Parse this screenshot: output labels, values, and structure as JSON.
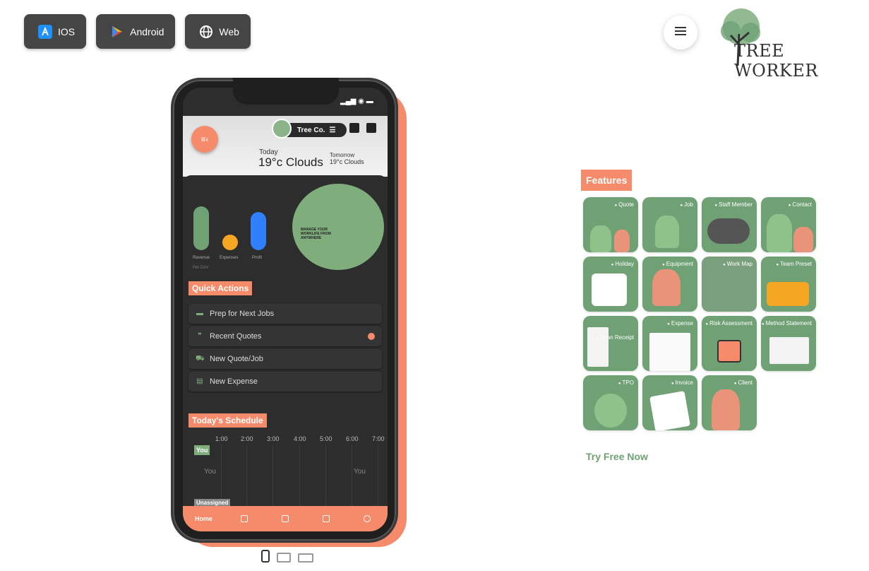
{
  "platforms": [
    {
      "label": "IOS",
      "icon": "app-store-icon"
    },
    {
      "label": "Android",
      "icon": "play-store-icon"
    },
    {
      "label": "Web",
      "icon": "globe-icon"
    }
  ],
  "brand": {
    "logo_text": "TREE WORKER"
  },
  "app": {
    "company": "Tree Co.",
    "weather": {
      "today_label": "Today",
      "today_value": "19°c Clouds",
      "tomorrow_label": "Tomorrow",
      "tomorrow_value": "19°c Clouds"
    },
    "stats": {
      "labels": [
        "Revenue",
        "Expenses",
        "Profit"
      ],
      "period": "Per DAY"
    },
    "hero_text": "MANAGE YOUR WORKLIFE FROM ANYWHERE",
    "quick_actions_title": "Quick Actions",
    "quick_actions": [
      {
        "label": "Prep for Next Jobs",
        "icon": "truck-icon"
      },
      {
        "label": "Recent Quotes",
        "icon": "quote-icon"
      },
      {
        "label": "New Quote/Job",
        "icon": "car-icon"
      },
      {
        "label": "New Expense",
        "icon": "receipt-icon"
      }
    ],
    "schedule_title": "Today's Schedule",
    "schedule_times": [
      "1:00",
      "2:00",
      "3:00",
      "4:00",
      "5:00",
      "6:00",
      "7:00"
    ],
    "schedule_you_tag": "You",
    "schedule_you_left": "You",
    "schedule_you_right": "You",
    "schedule_unassigned": "Unassigned",
    "tabs": [
      "Home"
    ]
  },
  "features": {
    "title": "Features",
    "items": [
      {
        "label": "Quote"
      },
      {
        "label": "Job"
      },
      {
        "label": "Staff Member"
      },
      {
        "label": "Contact"
      },
      {
        "label": "Holiday"
      },
      {
        "label": "Equipment"
      },
      {
        "label": "Work Map"
      },
      {
        "label": "Team Preset"
      },
      {
        "label": "Scan Receipt"
      },
      {
        "label": "Expense"
      },
      {
        "label": "Risk Assessment"
      },
      {
        "label": "Method Statement"
      },
      {
        "label": "TPO"
      },
      {
        "label": "Invoice"
      },
      {
        "label": "Client"
      }
    ],
    "cta": "Try Free Now"
  },
  "colors": {
    "accent": "#f68b6b",
    "green": "#6fa175",
    "dark": "#2d2d2d"
  }
}
